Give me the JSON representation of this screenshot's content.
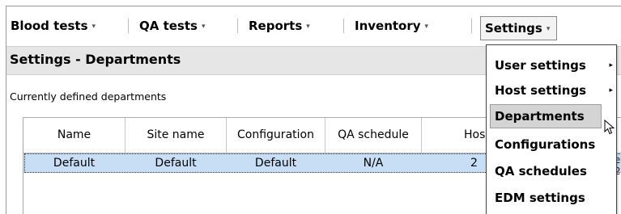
{
  "menubar": {
    "items": [
      {
        "label": "Blood tests",
        "arrow": "▾"
      },
      {
        "label": "QA tests",
        "arrow": "▾"
      },
      {
        "label": "Reports",
        "arrow": "▾"
      },
      {
        "label": "Inventory",
        "arrow": "▾"
      },
      {
        "label": "Settings",
        "arrow": "▾"
      }
    ]
  },
  "page": {
    "title": "Settings - Departments",
    "subtitle": "Currently defined departments"
  },
  "table": {
    "columns": [
      "Name",
      "Site name",
      "Configuration",
      "QA schedule",
      "Hos"
    ],
    "rows": [
      [
        "Default",
        "Default",
        "Default",
        "N/A",
        "2"
      ]
    ]
  },
  "right_edge": {
    "line1": "e",
    "line2": "2"
  },
  "dropdown": {
    "items": [
      {
        "label": "User settings",
        "submenu": "▸"
      },
      {
        "label": "Host settings",
        "submenu": "▸"
      },
      {
        "label": "Departments",
        "submenu": ""
      },
      {
        "label": "Configurations",
        "submenu": ""
      },
      {
        "label": "QA schedules",
        "submenu": ""
      },
      {
        "label": "EDM settings",
        "submenu": ""
      }
    ],
    "highlighted": "Departments"
  }
}
